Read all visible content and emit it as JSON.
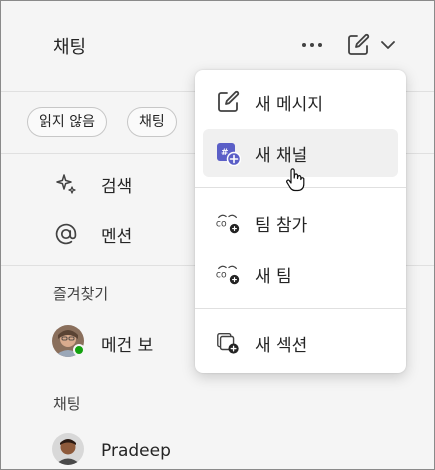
{
  "header": {
    "title": "채팅"
  },
  "filters": [
    {
      "label": "읽지 않음"
    },
    {
      "label": "채팅"
    }
  ],
  "nav": [
    {
      "label": "검색",
      "icon": "sparkle-icon"
    },
    {
      "label": "멘션",
      "icon": "at-icon"
    }
  ],
  "favorites": {
    "label": "즐겨찾기",
    "items": [
      {
        "name": "메건 보",
        "presence": "available"
      }
    ]
  },
  "chats": {
    "label": "채팅",
    "items": [
      {
        "name": "Pradeep"
      }
    ]
  },
  "menu": {
    "items": [
      {
        "label": "새 메시지",
        "icon": "compose-icon"
      },
      {
        "label": "새 채널",
        "icon": "new-channel-icon"
      },
      {
        "label": "팀 참가",
        "icon": "join-team-icon"
      },
      {
        "label": "새 팀",
        "icon": "new-team-icon"
      },
      {
        "label": "새 섹션",
        "icon": "new-section-icon"
      }
    ]
  },
  "colors": {
    "accent": "#5b5fc7",
    "presence_available": "#13a10e"
  }
}
